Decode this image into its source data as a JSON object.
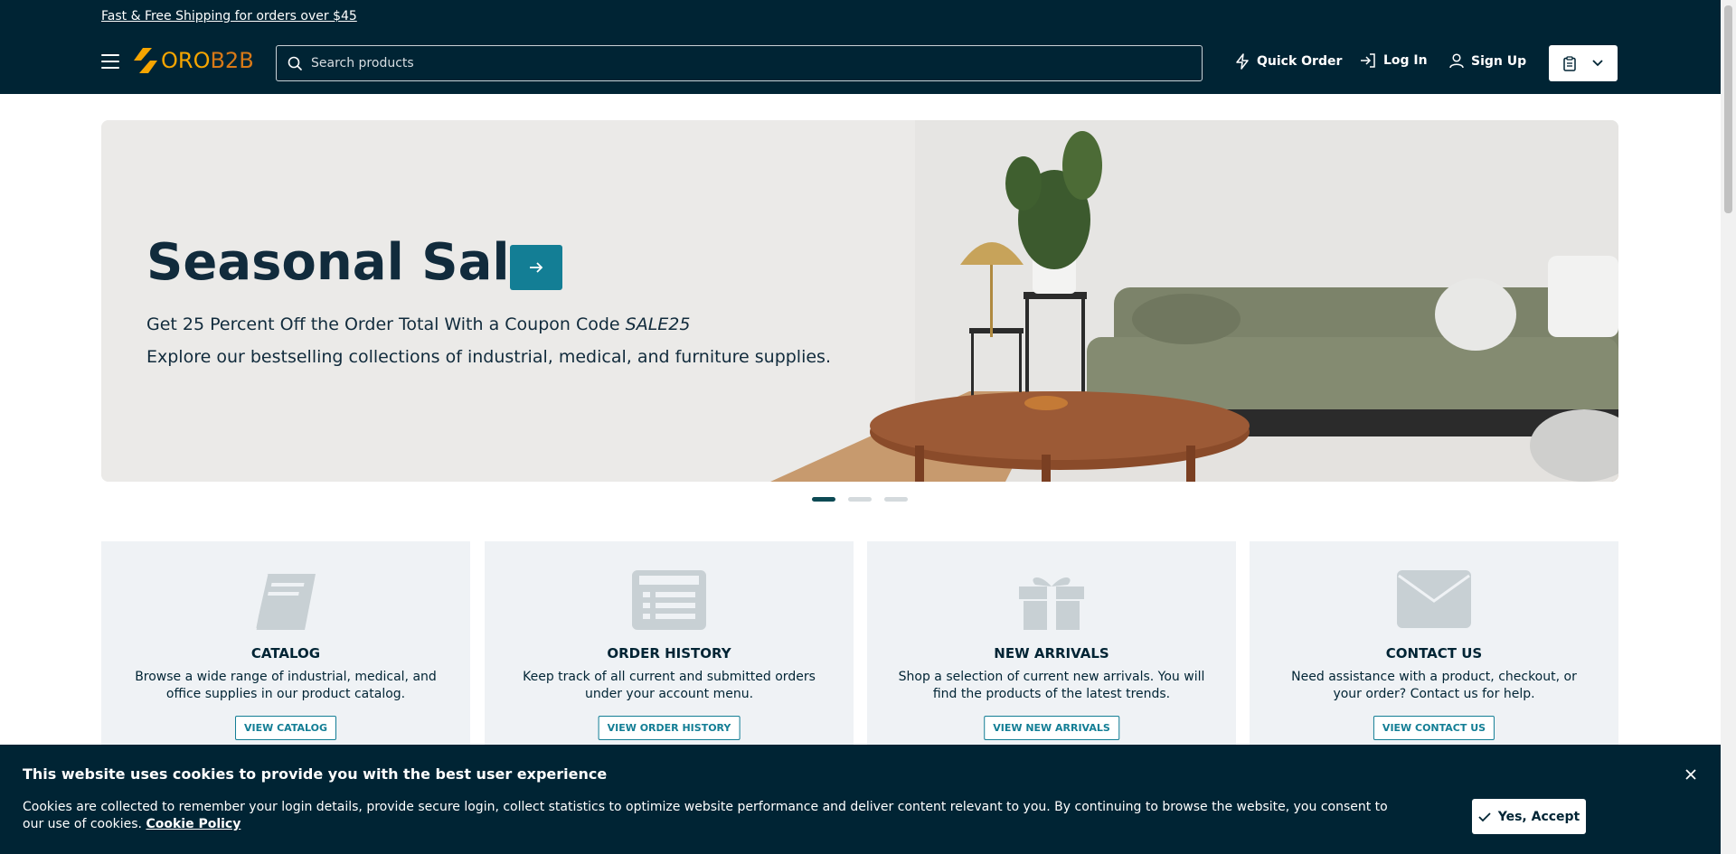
{
  "header": {
    "promo_text": "Fast & Free Shipping for orders over $45",
    "logo_oro": "ORO",
    "logo_b2b": "B2B",
    "search_placeholder": "Search products",
    "quick_order": "Quick Order",
    "log_in": "Log In",
    "sign_up": "Sign Up"
  },
  "hero": {
    "title": "Seasonal Sale",
    "subtitle_prefix": "Get 25 Percent Off the Order Total With a Coupon Code ",
    "coupon_code": "SALE25",
    "subtitle2": "Explore our bestselling collections of industrial, medical, and furniture supplies.",
    "slides": 3,
    "active_slide": 1
  },
  "cards": [
    {
      "title": "CATALOG",
      "desc": "Browse a wide range of industrial, medical, and office supplies in our product catalog.",
      "button": "VIEW CATALOG",
      "icon": "book-icon"
    },
    {
      "title": "ORDER HISTORY",
      "desc": "Keep track of all current and submitted orders under your account menu.",
      "button": "VIEW ORDER HISTORY",
      "icon": "list-icon"
    },
    {
      "title": "NEW ARRIVALS",
      "desc": "Shop a selection of current new arrivals. You will find the products of the latest trends.",
      "button": "VIEW NEW ARRIVALS",
      "icon": "gift-icon"
    },
    {
      "title": "CONTACT US",
      "desc": "Need assistance with a product, checkout, or your order? Contact us for help.",
      "button": "VIEW CONTACT US",
      "icon": "envelope-icon"
    }
  ],
  "cookie": {
    "title": "This website uses cookies to provide you with the best user experience",
    "text": "Cookies are collected to remember your login details, provide secure login, collect statistics to optimize website performance and deliver content relevant to you. By continuing to browse the website, you consent to our use of cookies.",
    "policy_link": "Cookie Policy",
    "accept": "Yes, Accept"
  },
  "colors": {
    "header_bg": "#002434",
    "accent": "#137e95",
    "card_bg": "#eff2f5",
    "logo_orange": "#f6a500"
  }
}
